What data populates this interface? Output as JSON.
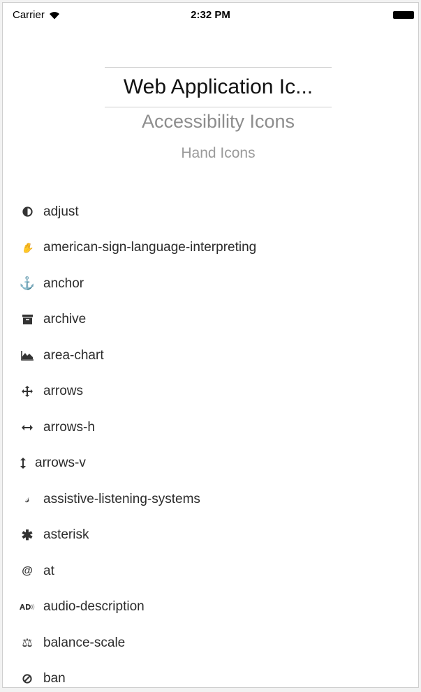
{
  "status_bar": {
    "carrier": "Carrier",
    "time": "2:32 PM"
  },
  "picker": {
    "selected": "Web Application Ic...",
    "options": [
      "Accessibility Icons",
      "Hand Icons"
    ]
  },
  "icons": [
    {
      "name": "adjust",
      "icon": "adjust-icon"
    },
    {
      "name": "american-sign-language-interpreting",
      "icon": "american-sign-language-interpreting-icon"
    },
    {
      "name": "anchor",
      "icon": "anchor-icon"
    },
    {
      "name": "archive",
      "icon": "archive-icon"
    },
    {
      "name": "area-chart",
      "icon": "area-chart-icon"
    },
    {
      "name": "arrows",
      "icon": "arrows-icon"
    },
    {
      "name": "arrows-h",
      "icon": "arrows-h-icon"
    },
    {
      "name": "arrows-v",
      "icon": "arrows-v-icon"
    },
    {
      "name": "assistive-listening-systems",
      "icon": "assistive-listening-systems-icon"
    },
    {
      "name": "asterisk",
      "icon": "asterisk-icon"
    },
    {
      "name": "at",
      "icon": "at-icon"
    },
    {
      "name": "audio-description",
      "icon": "audio-description-icon"
    },
    {
      "name": "balance-scale",
      "icon": "balance-scale-icon"
    },
    {
      "name": "ban",
      "icon": "ban-icon"
    }
  ]
}
